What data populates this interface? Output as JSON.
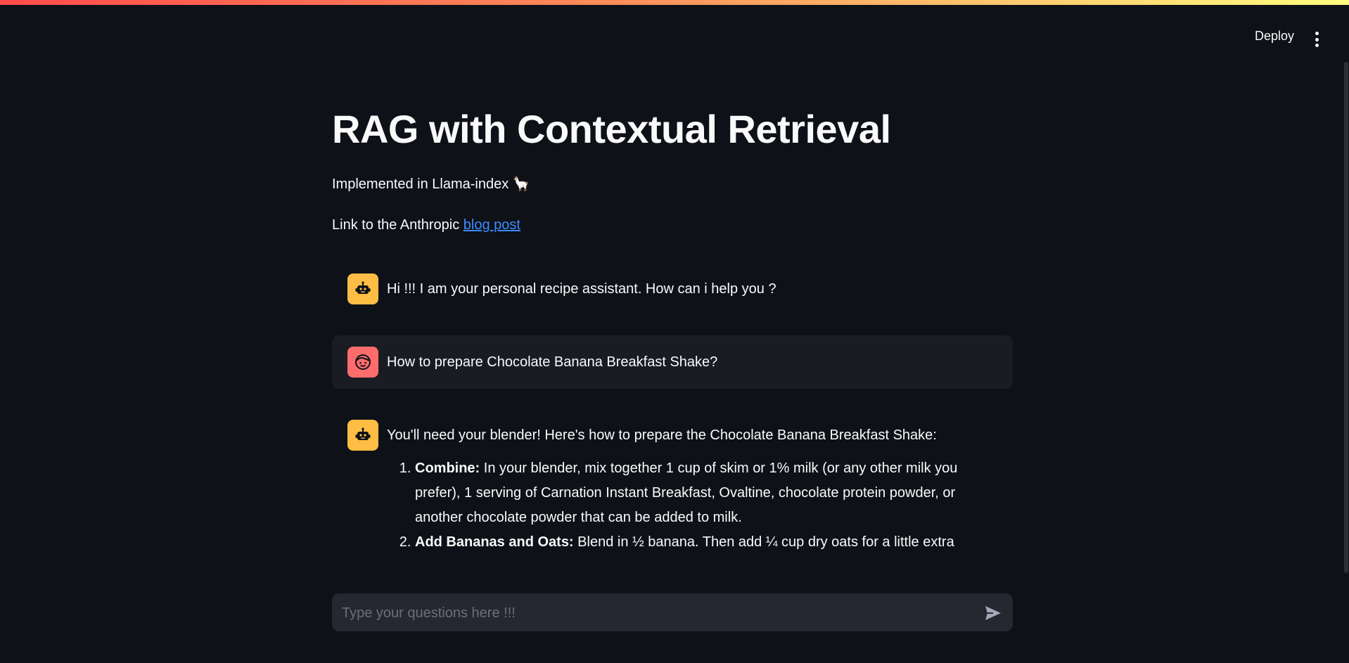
{
  "header": {
    "deploy_label": "Deploy",
    "menu_icon": "kebab-menu-icon"
  },
  "main": {
    "title": "RAG with Contextual Retrieval",
    "subtitle": "Implemented in Llama-index 🦙",
    "link_prefix": "Link to the Anthropic ",
    "link_text": "blog post"
  },
  "messages": [
    {
      "role": "assistant",
      "avatar_icon": "robot-face-icon",
      "text": "Hi !!! I am your personal recipe assistant. How can i help you ?"
    },
    {
      "role": "user",
      "avatar_icon": "smiling-face-icon",
      "text": "How to prepare Chocolate Banana Breakfast Shake?"
    },
    {
      "role": "assistant",
      "avatar_icon": "robot-face-icon",
      "text": "You'll need your blender! Here's how to prepare the Chocolate Banana Breakfast Shake:",
      "steps": [
        {
          "bold": "Combine:",
          "text": " In your blender, mix together 1 cup of skim or 1% milk (or any other milk you prefer), 1 serving of Carnation Instant Breakfast, Ovaltine, chocolate protein powder, or another chocolate powder that can be added to milk."
        },
        {
          "bold": "Add Bananas and Oats:",
          "text": " Blend in ½ banana. Then add ¼ cup dry oats for a little extra"
        }
      ]
    }
  ],
  "chat_input": {
    "placeholder": "Type your questions here !!!",
    "send_icon": "send-arrow-icon"
  },
  "colors": {
    "background": "#0e1117",
    "assistant_avatar": "#ffbd45",
    "user_avatar": "#ff6c6c",
    "link": "#3d8bff",
    "input_bg": "#262730"
  }
}
